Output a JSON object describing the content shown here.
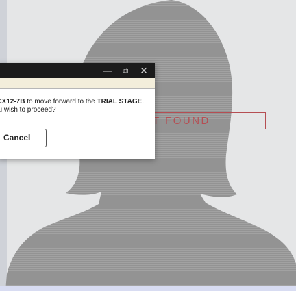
{
  "dialog": {
    "window_controls": {
      "minimize": "—",
      "maximize": "⧉",
      "close": "✕"
    },
    "message": {
      "code": "-CX12-7B",
      "middle": " to move forward to the ",
      "stage": "TRIAL STAGE",
      "end": ".",
      "line2": "ou wish to proceed?"
    },
    "cancel_label": "Cancel"
  },
  "background": {
    "not_found_text": "T FOUND"
  },
  "colors": {
    "silhouette": "#929292",
    "not_found_accent": "#b54e53",
    "titlebar": "#1b1b1b",
    "cream_band": "#f3eedb"
  },
  "icons": {
    "placeholder_avatar": "person-silhouette-icon"
  }
}
